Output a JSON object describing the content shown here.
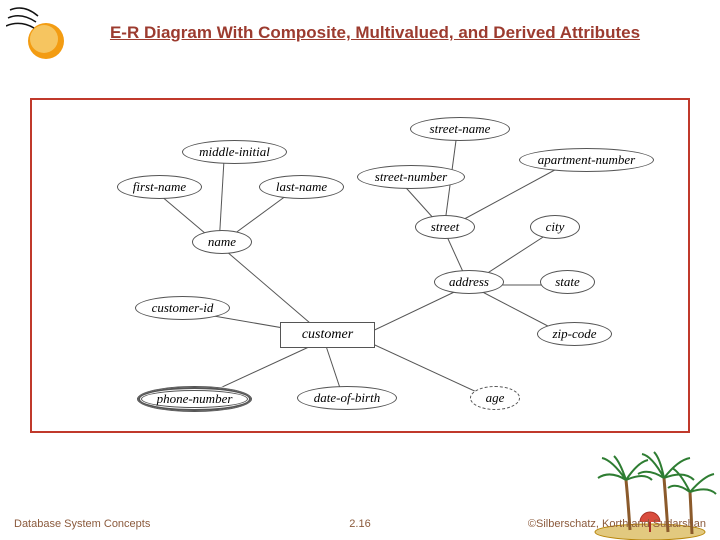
{
  "title": "E-R Diagram With Composite, Multivalued, and Derived Attributes",
  "entity": "customer",
  "attributes": {
    "customer_id": "customer-id",
    "name": "name",
    "first_name": "first-name",
    "middle_initial": "middle-initial",
    "last_name": "last-name",
    "address": "address",
    "street": "street",
    "street_number": "street-number",
    "street_name": "street-name",
    "apartment_number": "apartment-number",
    "city": "city",
    "state": "state",
    "zip_code": "zip-code",
    "phone_number": "phone-number",
    "date_of_birth": "date-of-birth",
    "age": "age"
  },
  "footer": {
    "left": "Database System Concepts",
    "center": "2.16",
    "right": "©Silberschatz, Korth and Sudarshan"
  },
  "colors": {
    "title_color": "#9c3b2f",
    "frame_border": "#c0392b"
  }
}
